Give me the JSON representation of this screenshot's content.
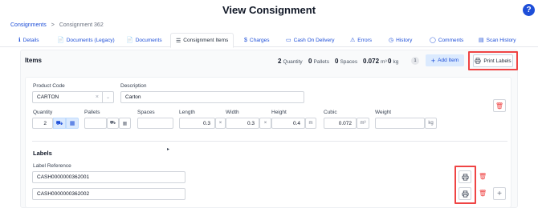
{
  "page": {
    "title": "View Consignment",
    "help": "?"
  },
  "breadcrumb": {
    "root": "Consignments",
    "sep": ">",
    "current": "Consignment 362"
  },
  "tabs": [
    {
      "label": "Details",
      "icon": "ℹ"
    },
    {
      "label": "Documents (Legacy)",
      "icon": "📄"
    },
    {
      "label": "Documents",
      "icon": "📄"
    },
    {
      "label": "Consignment Items",
      "icon": "☰"
    },
    {
      "label": "Charges",
      "icon": "$"
    },
    {
      "label": "Cash On Delivery",
      "icon": "▭"
    },
    {
      "label": "Errors",
      "icon": "⚠"
    },
    {
      "label": "History",
      "icon": "◷"
    },
    {
      "label": "Comments",
      "icon": "◯"
    },
    {
      "label": "Scan History",
      "icon": "▤"
    }
  ],
  "items": {
    "title": "Items",
    "quantity": {
      "value": "2",
      "label": "Quantity"
    },
    "pallets": {
      "value": "0",
      "label": "Pallets"
    },
    "spaces": {
      "value": "0",
      "label": "Spaces"
    },
    "cubic": {
      "value": "0.072",
      "label": "m³"
    },
    "weight": {
      "value": "0",
      "label": "kg"
    },
    "count_badge": "1",
    "add_label": "Add Item",
    "print_label": "Print Labels"
  },
  "item": {
    "product_code_label": "Product Code",
    "product_code": "CARTON",
    "description_label": "Description",
    "description": "Carton",
    "quantity_label": "Quantity",
    "quantity": "2",
    "pallets_label": "Pallets",
    "spaces_label": "Spaces",
    "length_label": "Length",
    "length": "0.3",
    "width_label": "Width",
    "width": "0.3",
    "height_label": "Height",
    "height": "0.4",
    "dim_unit": "m",
    "cubic_label": "Cubic",
    "cubic": "0.072",
    "cubic_unit": "m³",
    "weight_label": "Weight",
    "weight_unit": "kg",
    "times": "×"
  },
  "labels": {
    "title": "Labels",
    "ref_label": "Label Reference",
    "refs": [
      "CASH0000000362001",
      "CASH0000000362002"
    ]
  },
  "colors": {
    "accent": "#1d4ed8",
    "highlight": "#ef4444",
    "danger": "#ef4444"
  }
}
